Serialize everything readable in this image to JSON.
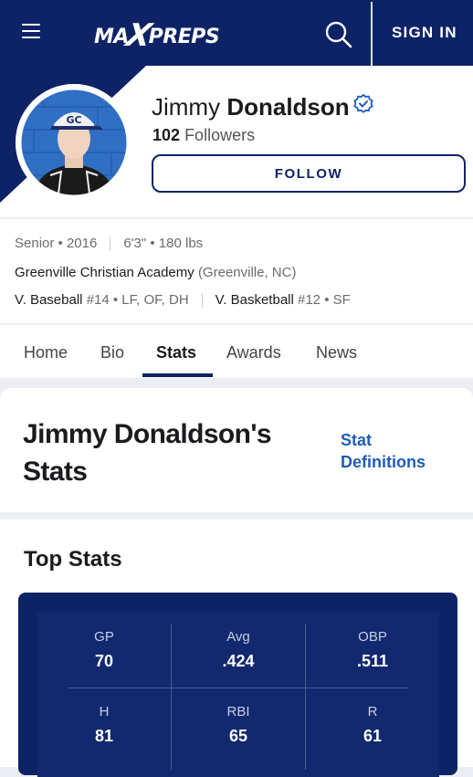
{
  "header": {
    "logo_text_a": "MA",
    "logo_text_x": "X",
    "logo_text_b": "PREPS",
    "signin_label": "SIGN IN",
    "colors": {
      "navy": "#0d2366",
      "link_blue": "#1f5bb8"
    },
    "icons": [
      "hamburger-menu-icon",
      "search-icon"
    ]
  },
  "profile": {
    "first_name": "Jimmy",
    "last_name": "Donaldson",
    "followers_count": "102",
    "followers_label": "Followers",
    "follow_label": "FOLLOW",
    "verified_icon": "verified-check-icon"
  },
  "info": {
    "class_year": "Senior • 2016",
    "size": "6'3\" • 180 lbs",
    "school": "Greenville Christian Academy",
    "location": "(Greenville, NC)",
    "sport1_name": "V. Baseball",
    "sport1_detail": "#14 • LF, OF, DH",
    "sport2_name": "V. Basketball",
    "sport2_detail": "#12 • SF"
  },
  "tabs": [
    {
      "label": "Home"
    },
    {
      "label": "Bio"
    },
    {
      "label": "Stats",
      "active": true
    },
    {
      "label": "Awards"
    },
    {
      "label": "News"
    }
  ],
  "stats_page": {
    "title": "Jimmy Donaldson's Stats",
    "definitions_link": "Stat Definitions",
    "top_stats_title": "Top Stats",
    "stats": [
      {
        "label": "GP",
        "value": "70"
      },
      {
        "label": "Avg",
        "value": ".424"
      },
      {
        "label": "OBP",
        "value": ".511"
      },
      {
        "label": "H",
        "value": "81"
      },
      {
        "label": "RBI",
        "value": "65"
      },
      {
        "label": "R",
        "value": "61"
      }
    ]
  }
}
